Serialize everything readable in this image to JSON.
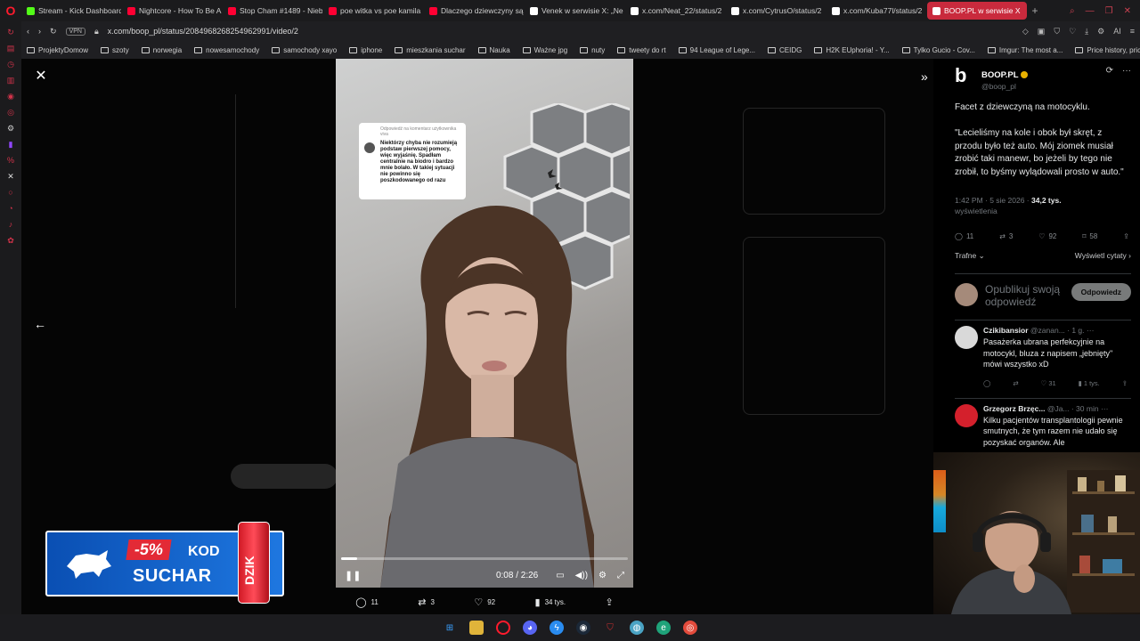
{
  "browser": {
    "tabs": [
      {
        "label": "Stream - Kick Dashboard",
        "icon": "kick-icon",
        "color": "#53fc18"
      },
      {
        "label": "Nightcore - How To Be A",
        "icon": "youtube-icon",
        "color": "#ff0033"
      },
      {
        "label": "Stop Cham #1489 - Nieb",
        "icon": "youtube-icon",
        "color": "#ff0033"
      },
      {
        "label": "poe witka vs poe kamila",
        "icon": "youtube-icon",
        "color": "#ff0033"
      },
      {
        "label": "Dlaczego dziewczyny są",
        "icon": "youtube-icon",
        "color": "#ff0033"
      },
      {
        "label": "Venek w serwisie X: „Ne",
        "icon": "x-icon",
        "color": "#ffffff"
      },
      {
        "label": "x.com/Neat_22/status/2",
        "icon": "x-icon",
        "color": "#ffffff"
      },
      {
        "label": "x.com/CytrusO/status/2",
        "icon": "x-icon",
        "color": "#ffffff"
      },
      {
        "label": "x.com/Kuba77l/status/2",
        "icon": "x-icon",
        "color": "#ffffff"
      },
      {
        "label": "BOOP.PL w serwisie X",
        "icon": "x-icon",
        "color": "#ffffff",
        "active": true
      }
    ],
    "new_tab": "+",
    "vpn": "VPN",
    "url": "x.com/boop_pl/status/2084968268254962991/video/2",
    "ai_label": "AI",
    "bookmarks": [
      "ProjektyDomow",
      "szoty",
      "norwegia",
      "nowesamochody",
      "samochody xayo",
      "iphone",
      "mieszkania suchar",
      "Nauka",
      "Ważne jpg",
      "nuty",
      "tweety do rt",
      "94 League of Lege...",
      "CEIDG",
      "H2K EUphoria! - Y...",
      "Tylko Gucio - Cov...",
      "Imgur: The most a...",
      "Price history, price..."
    ]
  },
  "viewer": {
    "close": "✕",
    "prev": "←",
    "expand": "»",
    "comment_card": {
      "header": "Odpowiedź na komentarz użytkownika viva",
      "text": "Niektórzy chyba nie rozumieją podstaw pierwszej pomocy, więc wyjaśnię. Spadłam centralnie na biodro i bardzo mnie bolało. W takiej sytuacji nie powinno się poszkodowanego od razu"
    },
    "time": "0:08 / 2:26",
    "progress": 0.055,
    "actions": {
      "replies": "11",
      "reposts": "3",
      "likes": "92",
      "views": "34 tys."
    }
  },
  "ad": {
    "discount": "-5%",
    "code_label": "KOD",
    "code": "SUCHAR",
    "can_text": "DZIK"
  },
  "tweet": {
    "author_name": "BOOP.PL",
    "author_handle": "@boop_pl",
    "text": "Facet z dziewczyną na motocyklu.\n\n\"Lecieliśmy na kole i obok był skręt, z przodu było też auto. Mój ziomek musiał zrobić taki manewr, bo jeżeli by tego nie zrobił, to byśmy wylądowali prosto w auto.\"",
    "timestamp": "1:42 PM · 5 sie 2026 ·",
    "views": "34,2 tys.",
    "views_label": "wyświetlenia",
    "stats": {
      "replies": "11",
      "reposts": "3",
      "likes": "92",
      "bookmarks": "58"
    },
    "sort_label": "Trafne",
    "quotes_label": "Wyświetl cytaty",
    "reply_placeholder": "Opublikuj swoją odpowiedź",
    "reply_button": "Odpowiedz"
  },
  "comments": [
    {
      "author": "Czikibansior",
      "handle": "@zanan... · 1 g.",
      "text": "Pasażerka ubrana perfekcyjnie na motocykl, bluza z napisem „jebnięty\" mówi wszystko xD",
      "likes": "31",
      "views": "1 tys.",
      "avatar_color": "#d9d9d9"
    },
    {
      "author": "Grzegorz Brzęc...",
      "handle": "@Ja... · 30 min",
      "text": "Kilku pacjentów transplantologii pewnie smutnych, że tym razem nie udało się pozyskać organów. Ale",
      "avatar_color": "#d4202c"
    }
  ]
}
